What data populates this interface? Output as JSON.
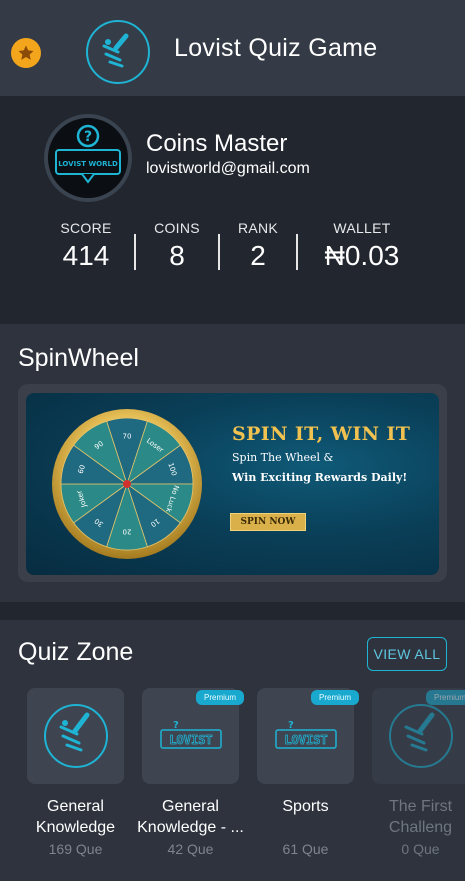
{
  "header": {
    "title": "Lovist Quiz Game",
    "star_icon": "star-icon",
    "logo_icon": "quiz-logo-icon"
  },
  "profile": {
    "name": "Coins Master",
    "email": "lovistworld@gmail.com",
    "avatar_text": "LOVIST WORLD",
    "stats": [
      {
        "label": "SCORE",
        "value": "414"
      },
      {
        "label": "COINS",
        "value": "8"
      },
      {
        "label": "RANK",
        "value": "2"
      },
      {
        "label": "WALLET",
        "value": "₦0.03"
      }
    ]
  },
  "spin": {
    "section_title": "SpinWheel",
    "banner_title": "SPIN IT, WIN IT",
    "banner_sub1": "Spin The Wheel &",
    "banner_sub2": "Win Exciting Rewards Daily!",
    "button_label": "SPIN NOW",
    "wheel_labels": [
      "70",
      "Loser",
      "100",
      "No Luck",
      "10",
      "20",
      "30",
      "Joker",
      "60",
      "90"
    ]
  },
  "quiz": {
    "section_title": "Quiz Zone",
    "view_all_label": "VIEW ALL",
    "premium_label": "Premium",
    "categories": [
      {
        "name": "General Knowledge",
        "count": "169 Que",
        "premium": false,
        "icon": "quiz-logo-icon"
      },
      {
        "name": "General Knowledge - ...",
        "count": "42 Que",
        "premium": true,
        "icon": "lovist-text-logo"
      },
      {
        "name": "Sports",
        "count": "61 Que",
        "premium": true,
        "icon": "lovist-text-logo"
      },
      {
        "name": "The First Challeng",
        "count": "0 Que",
        "premium": true,
        "icon": "quiz-logo-icon"
      }
    ],
    "logo_text": "LOVIST"
  },
  "colors": {
    "accent": "#1fb3d4",
    "header_bg": "#343b46",
    "page_bg": "#22262f",
    "section_bg": "#2e333d",
    "gold": "#f1c250"
  }
}
